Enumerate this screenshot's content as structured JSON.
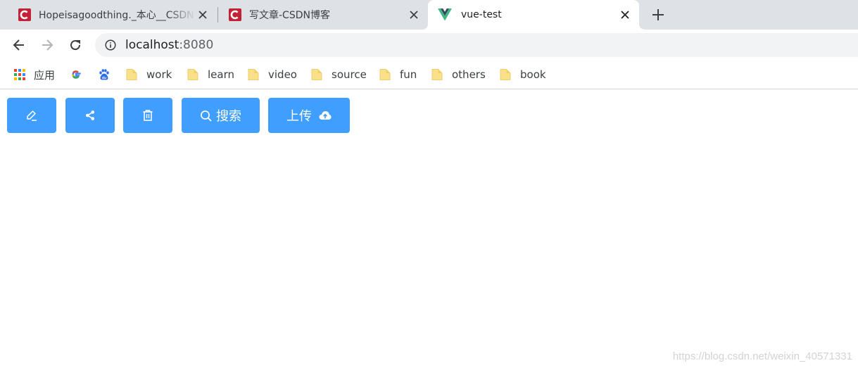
{
  "tabs": [
    {
      "title": "Hopeisagoodthing._本心__CSDN",
      "favicon": "csdn-icon",
      "active": false
    },
    {
      "title": "写文章-CSDN博客",
      "favicon": "csdn-icon",
      "active": false
    },
    {
      "title": "vue-test",
      "favicon": "vue-icon",
      "active": true
    }
  ],
  "toolbar": {
    "url_host": "localhost",
    "url_port": ":8080"
  },
  "bookmarks": {
    "apps_label": "应用",
    "folders": [
      "work",
      "learn",
      "video",
      "source",
      "fun",
      "others",
      "book"
    ]
  },
  "buttons": {
    "search_label": "搜索",
    "upload_label": "上传"
  },
  "colors": {
    "button_primary": "#409eff",
    "csdn_red": "#c32136",
    "vue_green": "#41b883",
    "vue_dark": "#35495e",
    "folder_yellow": "#fbe08a"
  },
  "watermark": "https://blog.csdn.net/weixin_40571331"
}
